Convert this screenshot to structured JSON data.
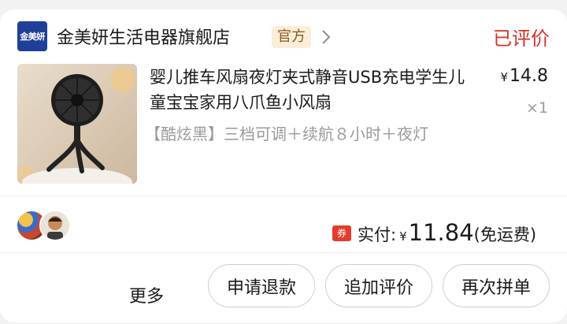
{
  "shop": {
    "logo_text": "金美妍",
    "name": "金美妍生活电器旗舰店",
    "tag": "官方"
  },
  "order": {
    "status": "已评价"
  },
  "product": {
    "title": "婴儿推车风扇夜灯夹式静音USB充电学生儿童宝宝家用八爪鱼小风扇",
    "variant": "【酷炫黑】三档可调＋续航８小时＋夜灯",
    "price_symbol": "¥",
    "price": "14.8",
    "quantity": "×1"
  },
  "summary": {
    "coupon_badge": "券",
    "paid_label": "实付:",
    "currency": "¥",
    "paid_amount": "11.84",
    "shipping_note": "(免运费)"
  },
  "actions": {
    "more": "更多",
    "refund": "申请退款",
    "add_review": "追加评价",
    "rebuy": "再次拼单"
  },
  "colors": {
    "status_red": "#d7302a",
    "coupon_red": "#e23b2c",
    "official_tag_bg": "#fbeed8",
    "logo_blue": "#1f3f98"
  }
}
